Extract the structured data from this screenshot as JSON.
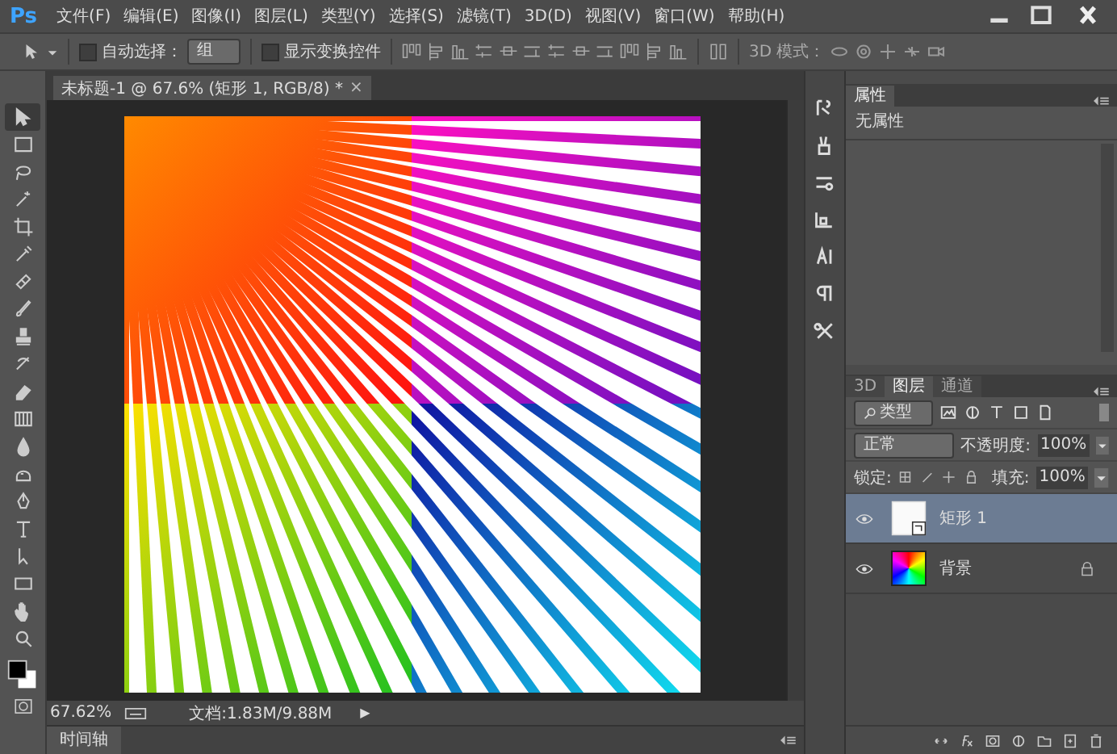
{
  "app_logo": "Ps",
  "menu": [
    "文件(F)",
    "编辑(E)",
    "图像(I)",
    "图层(L)",
    "类型(Y)",
    "选择(S)",
    "滤镜(T)",
    "3D(D)",
    "视图(V)",
    "窗口(W)",
    "帮助(H)"
  ],
  "options_bar": {
    "auto_select": {
      "label": "自动选择：",
      "checked": false
    },
    "target": "组",
    "show_transform": {
      "label": "显示变换控件",
      "checked": false
    },
    "mode_3d": "3D 模式："
  },
  "document_tab": {
    "title": "未标题-1 @ 67.6% (矩形 1, RGB/8) *",
    "close": "×"
  },
  "tools": [
    {
      "kind": "move",
      "selected": true
    },
    {
      "kind": "marquee",
      "selected": false
    },
    {
      "kind": "lasso",
      "selected": false
    },
    {
      "kind": "wand",
      "selected": false
    },
    {
      "kind": "crop",
      "selected": false
    },
    {
      "kind": "eyedropper",
      "selected": false
    },
    {
      "kind": "healing",
      "selected": false
    },
    {
      "kind": "brush",
      "selected": false
    },
    {
      "kind": "stamp",
      "selected": false
    },
    {
      "kind": "history",
      "selected": false
    },
    {
      "kind": "eraser",
      "selected": false
    },
    {
      "kind": "gradient",
      "selected": false
    },
    {
      "kind": "blur",
      "selected": false
    },
    {
      "kind": "dodge",
      "selected": false
    },
    {
      "kind": "pen",
      "selected": false
    },
    {
      "kind": "type",
      "selected": false
    },
    {
      "kind": "path",
      "selected": false
    },
    {
      "kind": "shape",
      "selected": false
    },
    {
      "kind": "hand",
      "selected": false
    },
    {
      "kind": "zoom",
      "selected": false
    }
  ],
  "status_bar": {
    "zoom": "67.62%",
    "document": "文档:1.83M/9.88M",
    "arrow": "▶"
  },
  "timeline": {
    "title": "时间轴"
  },
  "properties_panel": {
    "tab": "属性",
    "content": "无属性"
  },
  "layers_panel": {
    "tabs": [
      {
        "label": "3D",
        "selected": false
      },
      {
        "label": "图层",
        "selected": true
      },
      {
        "label": "通道",
        "selected": false
      }
    ],
    "filter": "类型",
    "blend_mode": "正常",
    "opacity_label": "不透明度:",
    "opacity": "100%",
    "lock_label": "锁定:",
    "fill_label": "填充:",
    "fill": "100%",
    "layers": [
      {
        "name": "矩形 1",
        "kind": "shape",
        "selected": true,
        "visible": true,
        "locked": false
      },
      {
        "name": "背景",
        "kind": "gradient",
        "selected": false,
        "visible": true,
        "locked": true
      }
    ]
  }
}
